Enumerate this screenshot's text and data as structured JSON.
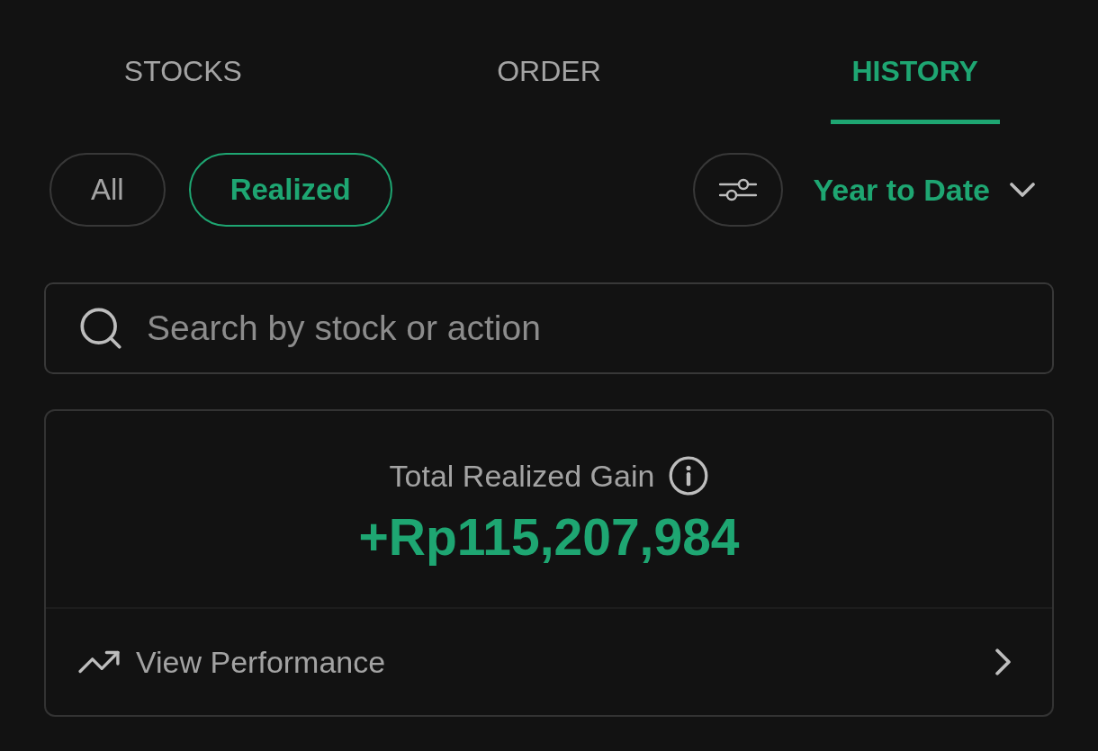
{
  "tabs": [
    {
      "label": "STOCKS",
      "selected": false
    },
    {
      "label": "ORDER",
      "selected": false
    },
    {
      "label": "HISTORY",
      "selected": true
    }
  ],
  "filters": [
    {
      "label": "All",
      "selected": false
    },
    {
      "label": "Realized",
      "selected": true
    }
  ],
  "period": {
    "label": "Year to Date"
  },
  "search": {
    "placeholder": "Search by stock or action"
  },
  "summary": {
    "title": "Total Realized Gain",
    "value": "+Rp115,207,984"
  },
  "link": {
    "label": "View Performance"
  }
}
